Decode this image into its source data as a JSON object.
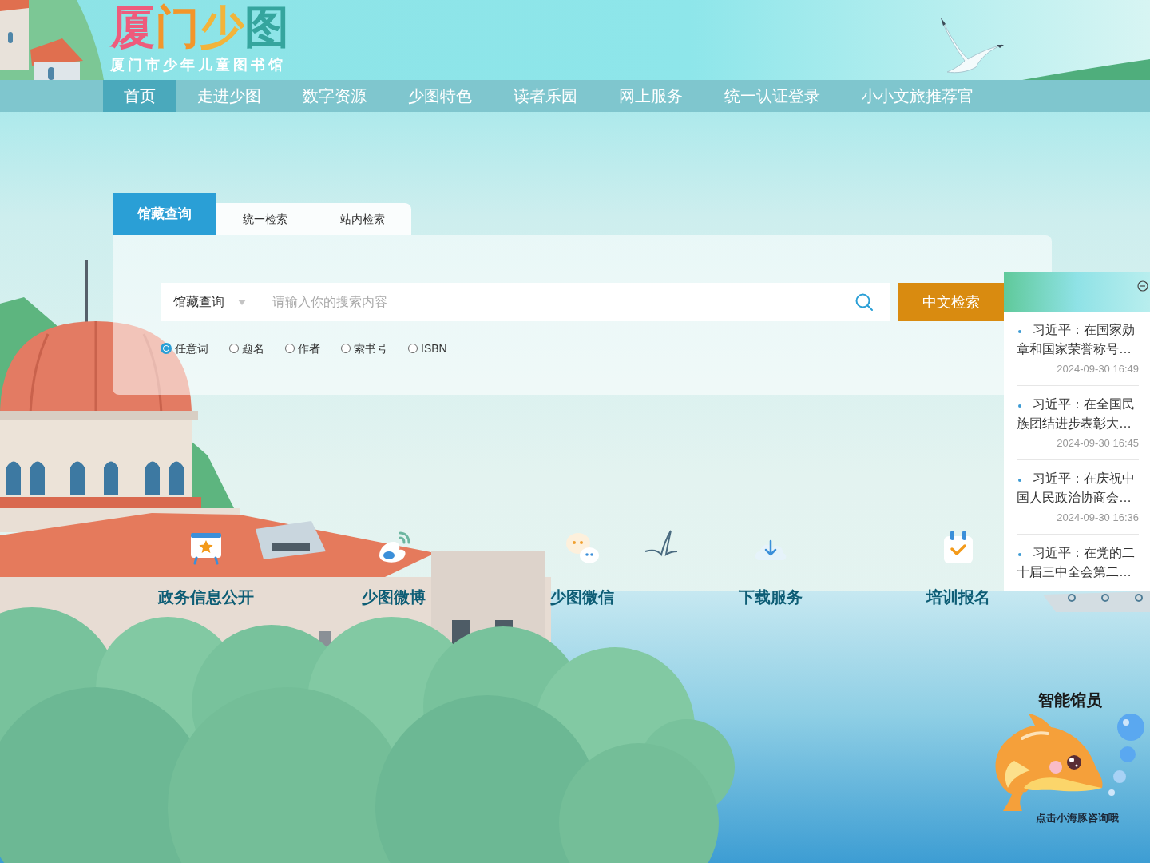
{
  "logo": {
    "title": "厦门少图",
    "subtitle": "厦门市少年儿童图书馆"
  },
  "nav": [
    {
      "label": "首页",
      "selected": true
    },
    {
      "label": "走进少图",
      "selected": false
    },
    {
      "label": "数字资源",
      "selected": false
    },
    {
      "label": "少图特色",
      "selected": false
    },
    {
      "label": "读者乐园",
      "selected": false
    },
    {
      "label": "网上服务",
      "selected": false
    },
    {
      "label": "统一认证登录",
      "selected": false
    },
    {
      "label": "小小文旅推荐官",
      "selected": false
    }
  ],
  "search": {
    "tabs": [
      {
        "label": "馆藏查询",
        "selected": true
      },
      {
        "label": "统一检索",
        "selected": false
      },
      {
        "label": "站内检索",
        "selected": false
      }
    ],
    "scope": {
      "value": "馆藏查询"
    },
    "query": {
      "placeholder": "请输入你的搜索内容"
    },
    "button": "中文检索",
    "fields": [
      {
        "label": "任意词",
        "selected": true
      },
      {
        "label": "题名",
        "selected": false
      },
      {
        "label": "作者",
        "selected": false
      },
      {
        "label": "索书号",
        "selected": false
      },
      {
        "label": "ISBN",
        "selected": false
      }
    ]
  },
  "services": [
    {
      "label": "政务信息公开"
    },
    {
      "label": "少图微博"
    },
    {
      "label": "少图微信"
    },
    {
      "label": "下载服务"
    },
    {
      "label": "培训报名"
    }
  ],
  "news": [
    {
      "title": "习近平：在国家勋章和国家荣誉称号…",
      "date": "2024-09-30 16:49"
    },
    {
      "title": "习近平：在全国民族团结进步表彰大…",
      "date": "2024-09-30 16:45"
    },
    {
      "title": "习近平：在庆祝中国人民政治协商会…",
      "date": "2024-09-30 16:36"
    },
    {
      "title": "习近平：在党的二十届三中全会第二…"
    }
  ],
  "assistant": {
    "title": "智能馆员",
    "hint": "点击小海豚咨询哦"
  }
}
